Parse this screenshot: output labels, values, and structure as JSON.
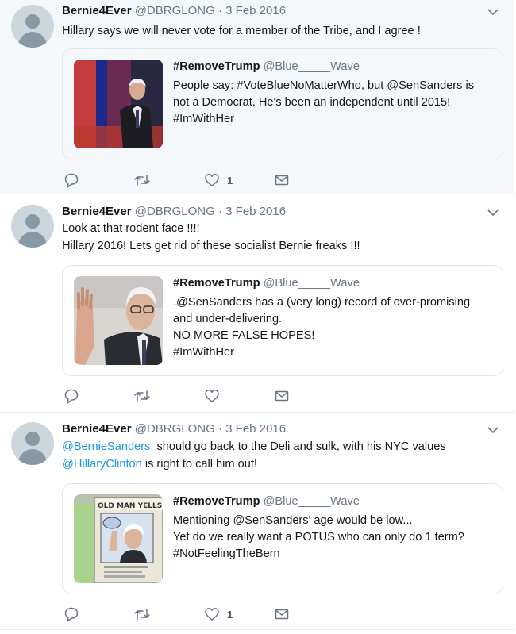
{
  "tweets": [
    {
      "name": "Bernie4Ever",
      "handle": "@DBRGLONG",
      "separator": "·",
      "date": "3 Feb 2016",
      "text_lines": [
        "Hillary says we will never vote for a member of the Tribe, and I agree !"
      ],
      "quote": {
        "name": "#RemoveTrump",
        "handle": "@Blue_____Wave",
        "lines": [
          "People say: #VoteBlueNoMatterWho, but @SenSanders is",
          "not a Democrat. He's been an independent until 2015!",
          "#ImWithHer"
        ],
        "image": "bernie-on-debate-stage-photo"
      },
      "like_count": "1"
    },
    {
      "name": "Bernie4Ever",
      "handle": "@DBRGLONG",
      "separator": "·",
      "date": "3 Feb 2016",
      "text_lines": [
        "Look at that rodent face !!!!",
        "Hillary 2016! Lets get rid of these socialist Bernie freaks !!!"
      ],
      "quote": {
        "name": "#RemoveTrump",
        "handle": "@Blue_____Wave",
        "lines": [
          ".@SenSanders has a (very long) record of over-promising",
          "and under-delivering.",
          "NO MORE FALSE HOPES!",
          "#ImWithHer"
        ],
        "image": "bernie-waving-photo"
      },
      "like_count": ""
    },
    {
      "name": "Bernie4Ever",
      "handle": "@DBRGLONG",
      "separator": "·",
      "date": "3 Feb 2016",
      "text_line1_mention": "@BernieSanders",
      "text_line1_rest": "  should go back to the Deli and sulk, with his NYC values",
      "text_line2_mention": "@HillaryClinton",
      "text_line2_rest": " is right to call him out!",
      "quote": {
        "name": "#RemoveTrump",
        "handle": "@Blue_____Wave",
        "lines": [
          "Mentioning @SenSanders' age would be low...",
          "Yet do we really want a POTUS who can only do 1 term?",
          "#NotFeelingTheBern"
        ],
        "image": "old-man-yells-at-cloud-cartoon",
        "image_caption": "OLD MAN YELLS AT CL"
      },
      "like_count": "1"
    }
  ],
  "colors": {
    "link": "#1b95e0",
    "muted": "#657786",
    "highlight_bg": "#f5f8fa",
    "border": "#e1e8ed",
    "accent": "#e0245e"
  }
}
